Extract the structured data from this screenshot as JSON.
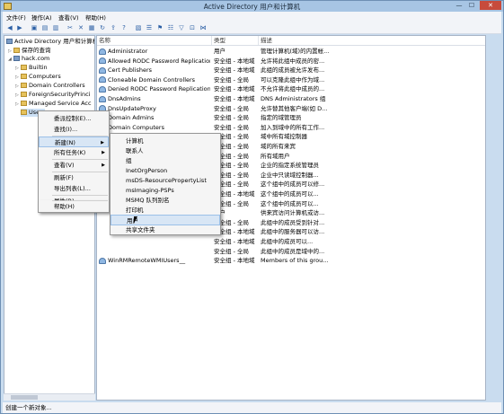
{
  "window": {
    "title": "Active Directory 用户和计算机",
    "min": "—",
    "max": "☐",
    "close": "✕"
  },
  "menu": [
    "文件(F)",
    "操作(A)",
    "查看(V)",
    "帮助(H)"
  ],
  "toolbar": [
    "◀",
    "▶",
    "▣",
    "▤",
    "▥",
    "✂",
    "✕",
    "▦",
    "↻",
    "⇪",
    "?",
    "▧",
    "☰",
    "⚑",
    "☷",
    "▽",
    "⊡",
    "⋈"
  ],
  "tree": [
    {
      "label": "Active Directory 用户和计算机",
      "tri": "",
      "icon": "dicon"
    },
    {
      "label": "保存的查询",
      "tri": "▷",
      "icon": "ficon"
    },
    {
      "label": "hack.com",
      "tri": "◢",
      "icon": "dicon"
    },
    {
      "label": "Builtin",
      "tri": "▷",
      "icon": "ficon"
    },
    {
      "label": "Computers",
      "tri": "▷",
      "icon": "ficon"
    },
    {
      "label": "Domain Controllers",
      "tri": "▷",
      "icon": "ficon"
    },
    {
      "label": "ForeignSecurityPrinci",
      "tri": "▷",
      "icon": "ficon"
    },
    {
      "label": "Managed Service Acc",
      "tri": "▷",
      "icon": "ficon"
    },
    {
      "label": "Users",
      "tri": "",
      "icon": "ficon"
    }
  ],
  "columns": {
    "name": "名称",
    "type": "类型",
    "desc": "描述"
  },
  "rows": [
    {
      "name": "Administrator",
      "type": "用户",
      "desc": "管理计算机(域)的内置帐..."
    },
    {
      "name": "Allowed RODC Password Replication ...",
      "type": "安全组 - 本地域",
      "desc": "允许将此组中成员的密..."
    },
    {
      "name": "Cert Publishers",
      "type": "安全组 - 本地域",
      "desc": "此组的成员被允许发布..."
    },
    {
      "name": "Cloneable Domain Controllers",
      "type": "安全组 - 全局",
      "desc": "可以克隆此组中作为域..."
    },
    {
      "name": "Denied RODC Password Replication ...",
      "type": "安全组 - 本地域",
      "desc": "不允许将此组中成员的..."
    },
    {
      "name": "DnsAdmins",
      "type": "安全组 - 本地域",
      "desc": "DNS Administrators 组"
    },
    {
      "name": "DnsUpdateProxy",
      "type": "安全组 - 全局",
      "desc": "允许替其他客户端(如 D..."
    },
    {
      "name": "Domain Admins",
      "type": "安全组 - 全局",
      "desc": "指定的域管理员"
    },
    {
      "name": "Domain Computers",
      "type": "安全组 - 全局",
      "desc": "加入到域中的所有工作..."
    },
    {
      "name": "",
      "type": "安全组 - 全局",
      "desc": "域中所有域控制器"
    },
    {
      "name": "",
      "type": "安全组 - 全局",
      "desc": "域的所有来宾"
    },
    {
      "name": "",
      "type": "安全组 - 全局",
      "desc": "所有域用户"
    },
    {
      "name": "",
      "type": "安全组 - 全局",
      "desc": "企业的指定系统管理员"
    },
    {
      "name": "",
      "type": "安全组 - 全局",
      "desc": "企业中只读域控制器..."
    },
    {
      "name": "",
      "type": "安全组 - 全局",
      "desc": "这个组中的成员可以修..."
    },
    {
      "name": "",
      "type": "安全组 - 本地域",
      "desc": "这个组中的成员可以..."
    },
    {
      "name": "",
      "type": "安全组 - 全局",
      "desc": "这个组中的成员可以..."
    },
    {
      "name": "",
      "type": "用户",
      "desc": "供来宾访问计算机或访..."
    },
    {
      "name": "",
      "type": "安全组 - 全局",
      "desc": "此组中的成员受到针对..."
    },
    {
      "name": "",
      "type": "安全组 - 本地域",
      "desc": "此组中的服务器可以访..."
    },
    {
      "name": "",
      "type": "安全组 - 本地域",
      "desc": "此组中的成员可以..."
    },
    {
      "name": "",
      "type": "安全组 - 全局",
      "desc": "此组中的成员是域中的..."
    },
    {
      "name": "WinRMRemoteWMIUsers__",
      "type": "安全组 - 本地域",
      "desc": "Members of this grou..."
    }
  ],
  "context_menu": [
    {
      "label": "委派控制(E)...",
      "arrow": ""
    },
    {
      "label": "查找(I)...",
      "arrow": ""
    },
    {
      "label": "新建(N)",
      "arrow": "▶"
    },
    {
      "label": "所有任务(K)",
      "arrow": "▶"
    },
    {
      "label": "查看(V)",
      "arrow": "▶"
    },
    {
      "label": "刷新(F)",
      "arrow": ""
    },
    {
      "label": "导出列表(L)...",
      "arrow": ""
    },
    {
      "label": "属性(R)",
      "arrow": ""
    },
    {
      "label": "帮助(H)",
      "arrow": ""
    }
  ],
  "submenu": [
    "计算机",
    "联系人",
    "组",
    "InetOrgPerson",
    "msDS-ResourcePropertyList",
    "msImaging-PSPs",
    "MSMQ 队列别名",
    "打印机",
    "用户",
    "共享文件夹"
  ],
  "status": "创建一个新对象..."
}
